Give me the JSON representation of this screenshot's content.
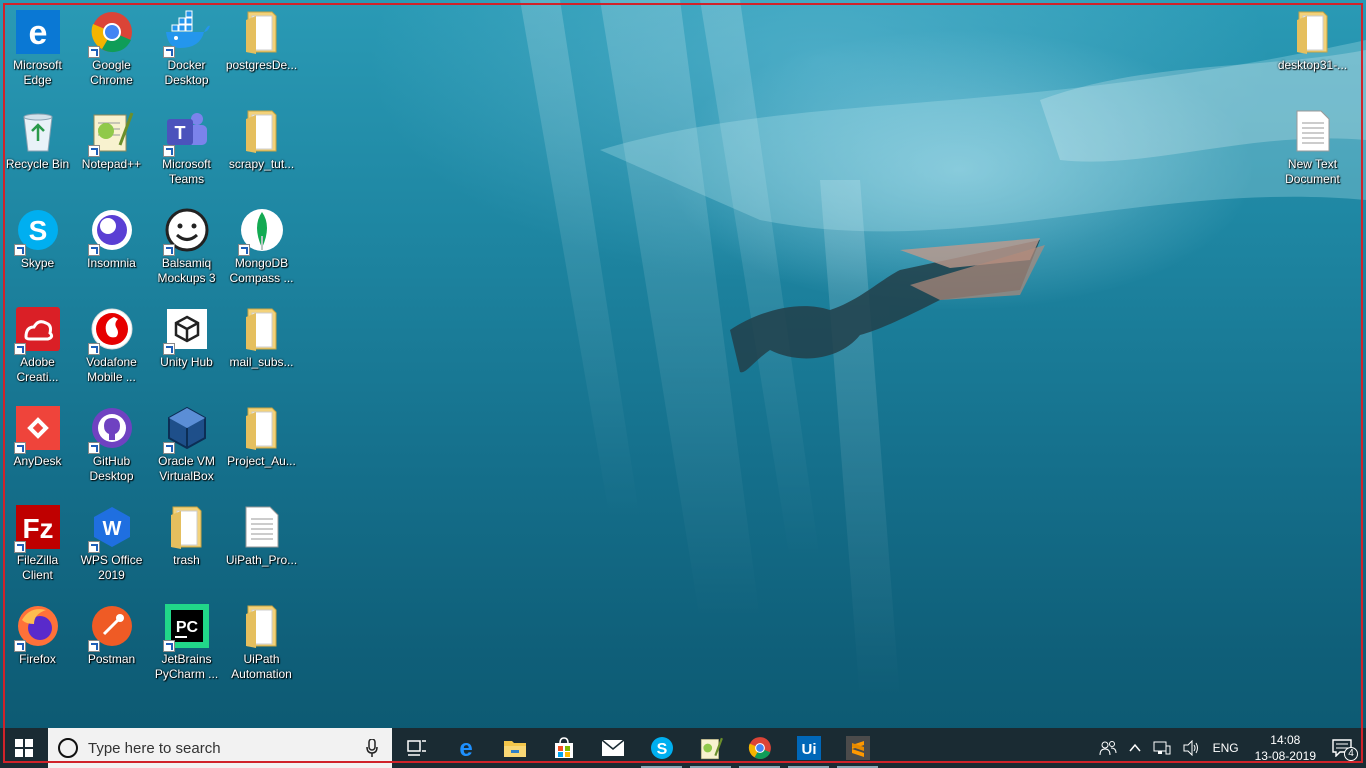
{
  "desktop": {
    "icons": [
      {
        "label": "Microsoft Edge",
        "icon": "edge-icon",
        "shortcut": false
      },
      {
        "label": "Google Chrome",
        "icon": "chrome-icon",
        "shortcut": true
      },
      {
        "label": "Docker Desktop",
        "icon": "docker-icon",
        "shortcut": true
      },
      {
        "label": "postgresDe...",
        "icon": "folder-icon",
        "shortcut": false
      },
      {
        "label": "Recycle Bin",
        "icon": "recycle-bin-icon",
        "shortcut": false
      },
      {
        "label": "Notepad++",
        "icon": "notepad-plus-plus-icon",
        "shortcut": true
      },
      {
        "label": "Microsoft Teams",
        "icon": "teams-icon",
        "shortcut": true
      },
      {
        "label": "scrapy_tut...",
        "icon": "folder-icon",
        "shortcut": false
      },
      {
        "label": "Skype",
        "icon": "skype-icon",
        "shortcut": true
      },
      {
        "label": "Insomnia",
        "icon": "insomnia-icon",
        "shortcut": true
      },
      {
        "label": "Balsamiq Mockups 3",
        "icon": "balsamiq-icon",
        "shortcut": true
      },
      {
        "label": "MongoDB Compass ...",
        "icon": "mongodb-compass-icon",
        "shortcut": true
      },
      {
        "label": "Adobe Creati...",
        "icon": "adobe-creative-cloud-icon",
        "shortcut": true
      },
      {
        "label": "Vodafone Mobile ...",
        "icon": "vodafone-icon",
        "shortcut": true
      },
      {
        "label": "Unity Hub",
        "icon": "unity-icon",
        "shortcut": true
      },
      {
        "label": "mail_subs...",
        "icon": "folder-icon",
        "shortcut": false
      },
      {
        "label": "AnyDesk",
        "icon": "anydesk-icon",
        "shortcut": true
      },
      {
        "label": "GitHub Desktop",
        "icon": "github-desktop-icon",
        "shortcut": true
      },
      {
        "label": "Oracle VM VirtualBox",
        "icon": "virtualbox-icon",
        "shortcut": true
      },
      {
        "label": "Project_Au...",
        "icon": "folder-icon",
        "shortcut": false
      },
      {
        "label": "FileZilla Client",
        "icon": "filezilla-icon",
        "shortcut": true
      },
      {
        "label": "WPS Office 2019",
        "icon": "wps-office-icon",
        "shortcut": true
      },
      {
        "label": "trash",
        "icon": "folder-icon",
        "shortcut": false
      },
      {
        "label": "UiPath_Pro...",
        "icon": "text-document-icon",
        "shortcut": false
      },
      {
        "label": "Firefox",
        "icon": "firefox-icon",
        "shortcut": true
      },
      {
        "label": "Postman",
        "icon": "postman-icon",
        "shortcut": true
      },
      {
        "label": "JetBrains PyCharm ...",
        "icon": "pycharm-icon",
        "shortcut": true
      },
      {
        "label": "UiPath Automation",
        "icon": "folder-icon",
        "shortcut": false
      }
    ],
    "right_icons": [
      {
        "label": "desktop31-...",
        "icon": "folder-icon"
      },
      {
        "label": "New Text Document",
        "icon": "text-document-icon"
      }
    ]
  },
  "taskbar": {
    "start_icon": "windows-start-icon",
    "search_placeholder": "Type here to search",
    "pinned": [
      {
        "name": "task-view",
        "icon": "task-view-icon",
        "running": false
      },
      {
        "name": "edge",
        "icon": "edge-icon",
        "running": false
      },
      {
        "name": "file-explorer",
        "icon": "file-explorer-icon",
        "running": false
      },
      {
        "name": "store",
        "icon": "store-icon",
        "running": false
      },
      {
        "name": "mail",
        "icon": "mail-icon",
        "running": false
      },
      {
        "name": "skype",
        "icon": "skype-icon",
        "running": true
      },
      {
        "name": "notepad-plus-plus",
        "icon": "notepad-plus-plus-icon",
        "running": true
      },
      {
        "name": "chrome",
        "icon": "chrome-icon",
        "running": true
      },
      {
        "name": "uipath",
        "icon": "uipath-icon",
        "running": true
      },
      {
        "name": "sublime-text",
        "icon": "sublime-text-icon",
        "running": true
      }
    ],
    "tray": {
      "language": "ENG",
      "time": "14:08",
      "date": "13-08-2019",
      "notification_count": "4"
    }
  },
  "colors": {
    "taskbar_bg": "#1a2b33",
    "frame_border": "#d0232a"
  }
}
